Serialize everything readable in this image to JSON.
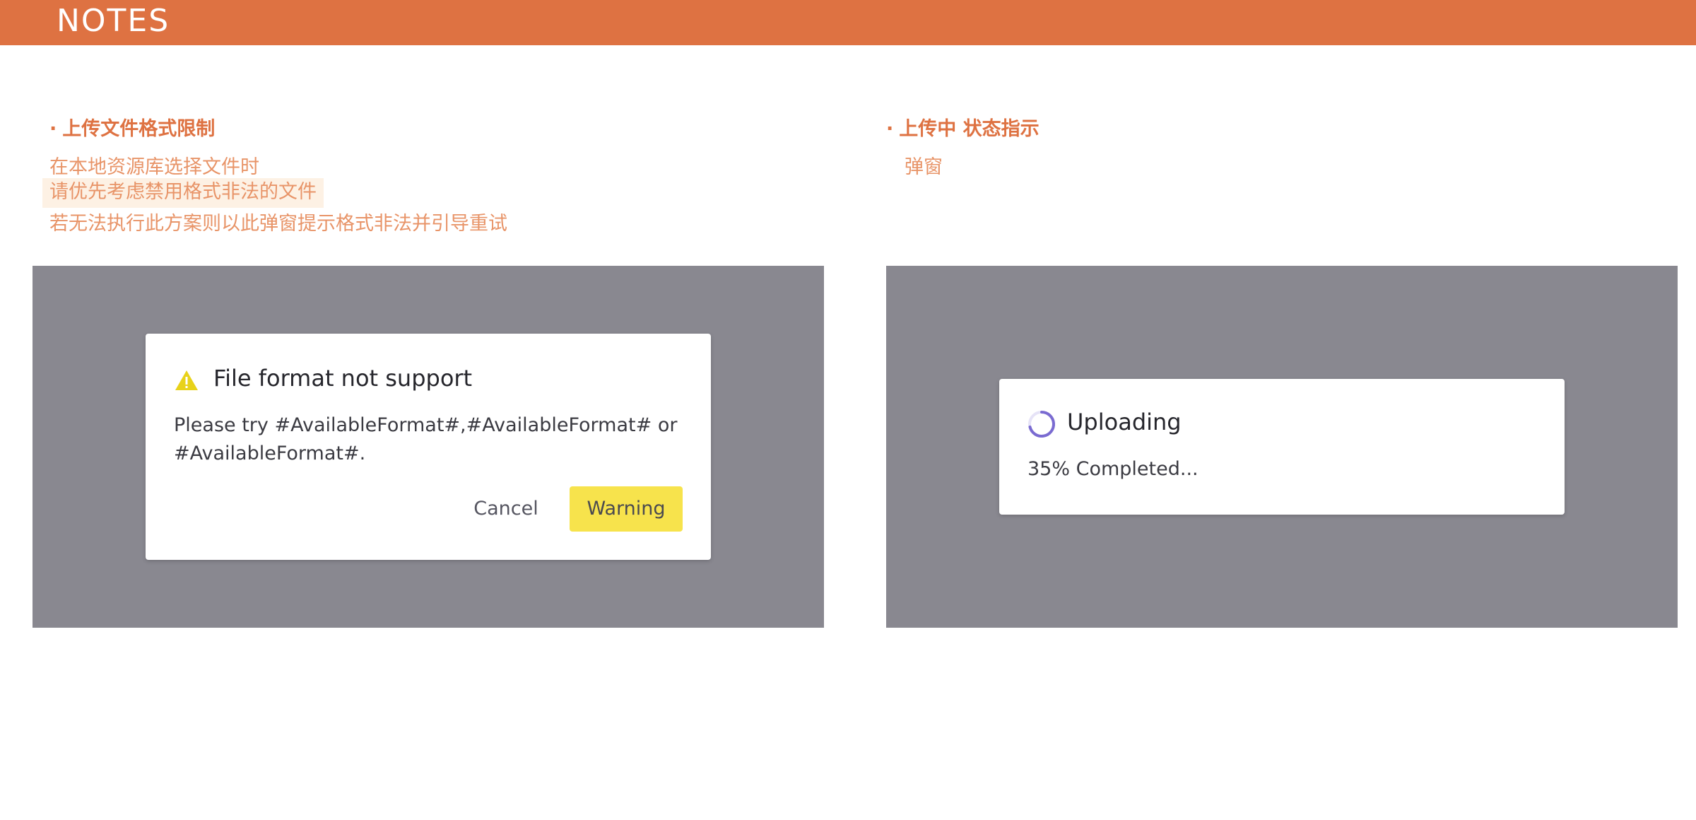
{
  "header": {
    "title": "NOTES"
  },
  "colors": {
    "accent": "#de7242",
    "overlay": "#898890",
    "warning_button": "#f7e34c",
    "spinner": "#7a6bd1"
  },
  "notes": {
    "left": {
      "bullet": "·",
      "title": "上传文件格式限制",
      "lines": [
        "在本地资源库选择文件时",
        "请优先考虑禁用格式非法的文件",
        "若无法执行此方案则以此弹窗提示格式非法并引导重试"
      ]
    },
    "right": {
      "bullet": "·",
      "title": "上传中 状态指示",
      "lines": [
        "弹窗"
      ]
    }
  },
  "dialog_format": {
    "icon": "warning-triangle-icon",
    "title": "File format not support",
    "message_line1": "Please try #AvailableFormat#,#AvailableFormat# or",
    "message_line2": "#AvailableFormat#.",
    "cancel_label": "Cancel",
    "warning_label": "Warning"
  },
  "dialog_upload": {
    "icon": "loading-spinner-icon",
    "title": "Uploading",
    "progress_percent": 35,
    "status": "35% Completed..."
  }
}
